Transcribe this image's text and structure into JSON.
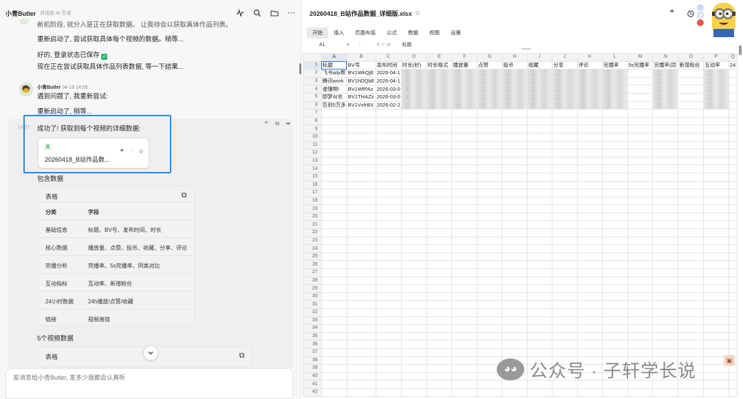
{
  "chat": {
    "header": {
      "name": "小青Butler",
      "subtitle": "对话由 AI 生成"
    },
    "messages_top": [
      "新机阶段, 就分入是正在获取数据。 让我待会以获取真体作品列表。",
      "重新启动了, 尝试获取具体每个视频的数据。稍等...",
      "好的, 登录状态已保存",
      "现在正在尝试获取具体作品列表数据, 等一下结果..."
    ],
    "reply": {
      "sender": "小青Butler",
      "time": "04-18 14:55",
      "lines": [
        "遇到问题了, 我重新尝试:",
        "重新启动了, 稍等..."
      ]
    },
    "hover_time": "14:57",
    "success_text": "成功了! 获取到每个视频的详细数据:",
    "file": {
      "badge": "X",
      "name": "20260418_B站作品数..."
    },
    "contains_label": "包含数据",
    "table1": {
      "title": "表格",
      "headers": [
        "分类",
        "字段"
      ],
      "rows": [
        [
          "基础信息",
          "标题、BV号、发布时间、时长"
        ],
        [
          "核心数据",
          "播放量、点赞、投币、收藏、分享、评论"
        ],
        [
          "完播分析",
          "完播率、5s完播率、同类对比"
        ],
        [
          "互动指标",
          "互动率、新增粉丝"
        ],
        [
          "24小时数据",
          "24h播放/点赞/收藏"
        ],
        [
          "链接",
          "视频直链"
        ]
      ]
    },
    "five_videos_label": "5个视频数据",
    "table2": {
      "title": "表格"
    },
    "input_placeholder": "发消息给小青Butler, 发多少我都会认真听"
  },
  "sheet": {
    "title": "20260418_B站作品数据_详细版.xlsx",
    "menu": [
      "开始",
      "插入",
      "页面布局",
      "公式",
      "数据",
      "视图",
      "设置"
    ],
    "active_menu": "开始",
    "cell_ref": "A1",
    "formula_value": "标题",
    "columns": [
      "A",
      "B",
      "C",
      "D",
      "E",
      "F",
      "G",
      "H",
      "I",
      "J",
      "K",
      "L",
      "M",
      "N",
      "O",
      "P",
      "Q"
    ],
    "header_row": [
      "标题",
      "BV号",
      "发布时间",
      "时长(秒)",
      "时长格式",
      "播放量",
      "点赞",
      "投币",
      "收藏",
      "分享",
      "评论",
      "完播率",
      "5s完播率",
      "完播率(同",
      "新增粉丝",
      "互动率",
      "24"
    ],
    "data_rows": [
      [
        "飞书aily帮",
        "BV1WkQjE",
        "2026-04-1"
      ],
      [
        "腾讯work",
        "BV1hDQbE",
        "2026-04-1"
      ],
      [
        "谁懂啊!",
        "BV1WfPAz",
        "2026-03-0"
      ],
      [
        "即梦AI长",
        "BV1THAZz",
        "2026-03-0"
      ],
      [
        "告别5万多",
        "BV1VxfrBX",
        "2026-02-2"
      ]
    ],
    "row_count": 42
  },
  "watermark": "公众号 · 子轩学长说"
}
